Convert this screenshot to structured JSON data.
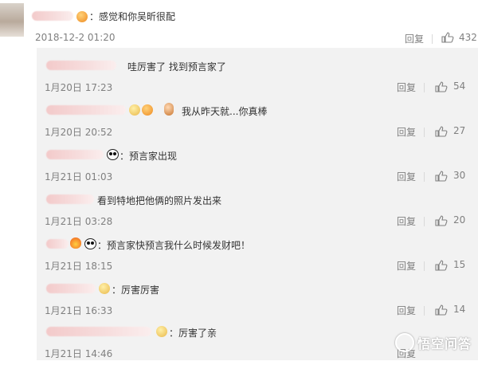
{
  "top_comment": {
    "text": "：感觉和你吴昕很配",
    "time": "2018-12-2 01:20",
    "reply": "回复",
    "likes": "432"
  },
  "replies": [
    {
      "text": "哇厉害了 找到预言家了",
      "time": "1月20日 17:23",
      "reply": "回复",
      "likes": "54"
    },
    {
      "text": "我从昨天就...你真棒",
      "time": "1月20日 20:52",
      "reply": "回复",
      "likes": "27"
    },
    {
      "text": "：预言家出现",
      "time": "1月21日 01:03",
      "reply": "回复",
      "likes": "30"
    },
    {
      "text": "看到特地把他俩的照片发出来",
      "time": "1月21日 03:28",
      "reply": "回复",
      "likes": "20"
    },
    {
      "text": "：预言家快预言我什么时候发财吧！",
      "time": "1月21日 18:15",
      "reply": "回复",
      "likes": "15"
    },
    {
      "text": "：厉害厉害",
      "time": "1月21日 16:33",
      "reply": "回复",
      "likes": "14"
    },
    {
      "text": "：厉害了亲",
      "time": "1月21日 14:46",
      "reply": "回复",
      "likes": ""
    }
  ],
  "watermark": "悟空问答",
  "icons": {
    "like": "thumbs-up-icon",
    "panda": "panda-emoji-icon",
    "orange": "emoji-face-icon",
    "gold": "emoji-grin-icon"
  },
  "colors": {
    "panel_bg": "#f2f2f2",
    "meta_gray": "#808080",
    "text": "#333333"
  }
}
